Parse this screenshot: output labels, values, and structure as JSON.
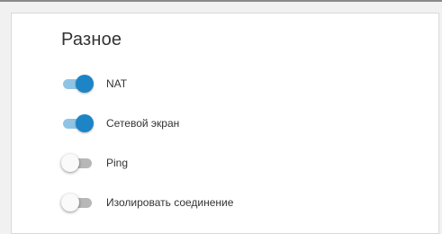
{
  "section": {
    "title": "Разное"
  },
  "toggles": [
    {
      "label": "NAT",
      "enabled": true
    },
    {
      "label": "Сетевой экран",
      "enabled": true
    },
    {
      "label": "Ping",
      "enabled": false
    },
    {
      "label": "Изолировать соединение",
      "enabled": false
    }
  ],
  "colors": {
    "accent": "#1d84c6",
    "accent_track": "#8fc4e4",
    "off_track": "#b7b7b7"
  }
}
